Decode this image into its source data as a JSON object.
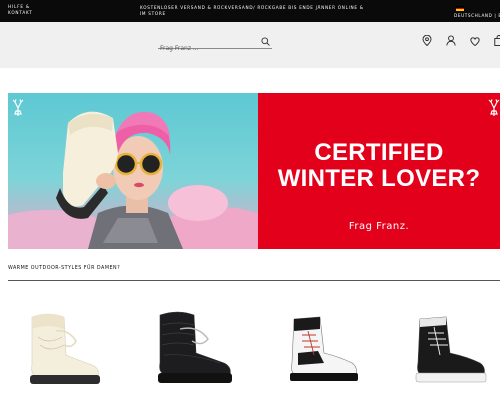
{
  "topbar": {
    "help": "HILFE & KONTAKT",
    "promo": "KOSTENLOSER VERSAND & RÜCKVERSAND/ RÜCKGABE BIS ENDE JÄNNER ONLINE & IM STORE",
    "country": "DEUTSCHLAND | E"
  },
  "search": {
    "placeholder": "Frag Franz ..."
  },
  "header_icons": [
    "location-pin-icon",
    "user-icon",
    "heart-icon",
    "bag-icon"
  ],
  "hero": {
    "title_line1": "CERTIFIED",
    "title_line2": "WINTER LOVER?",
    "brand": "Frag Franz.",
    "colors": {
      "red": "#e3001b",
      "sky": "#5dc8d3"
    }
  },
  "section": {
    "title": "WARME OUTDOOR-STYLES FÜR DAMEN?"
  },
  "products": [
    "cream-snow-boot",
    "black-snow-boot",
    "white-black-hiking-boot",
    "black-white-hiking-boot"
  ]
}
